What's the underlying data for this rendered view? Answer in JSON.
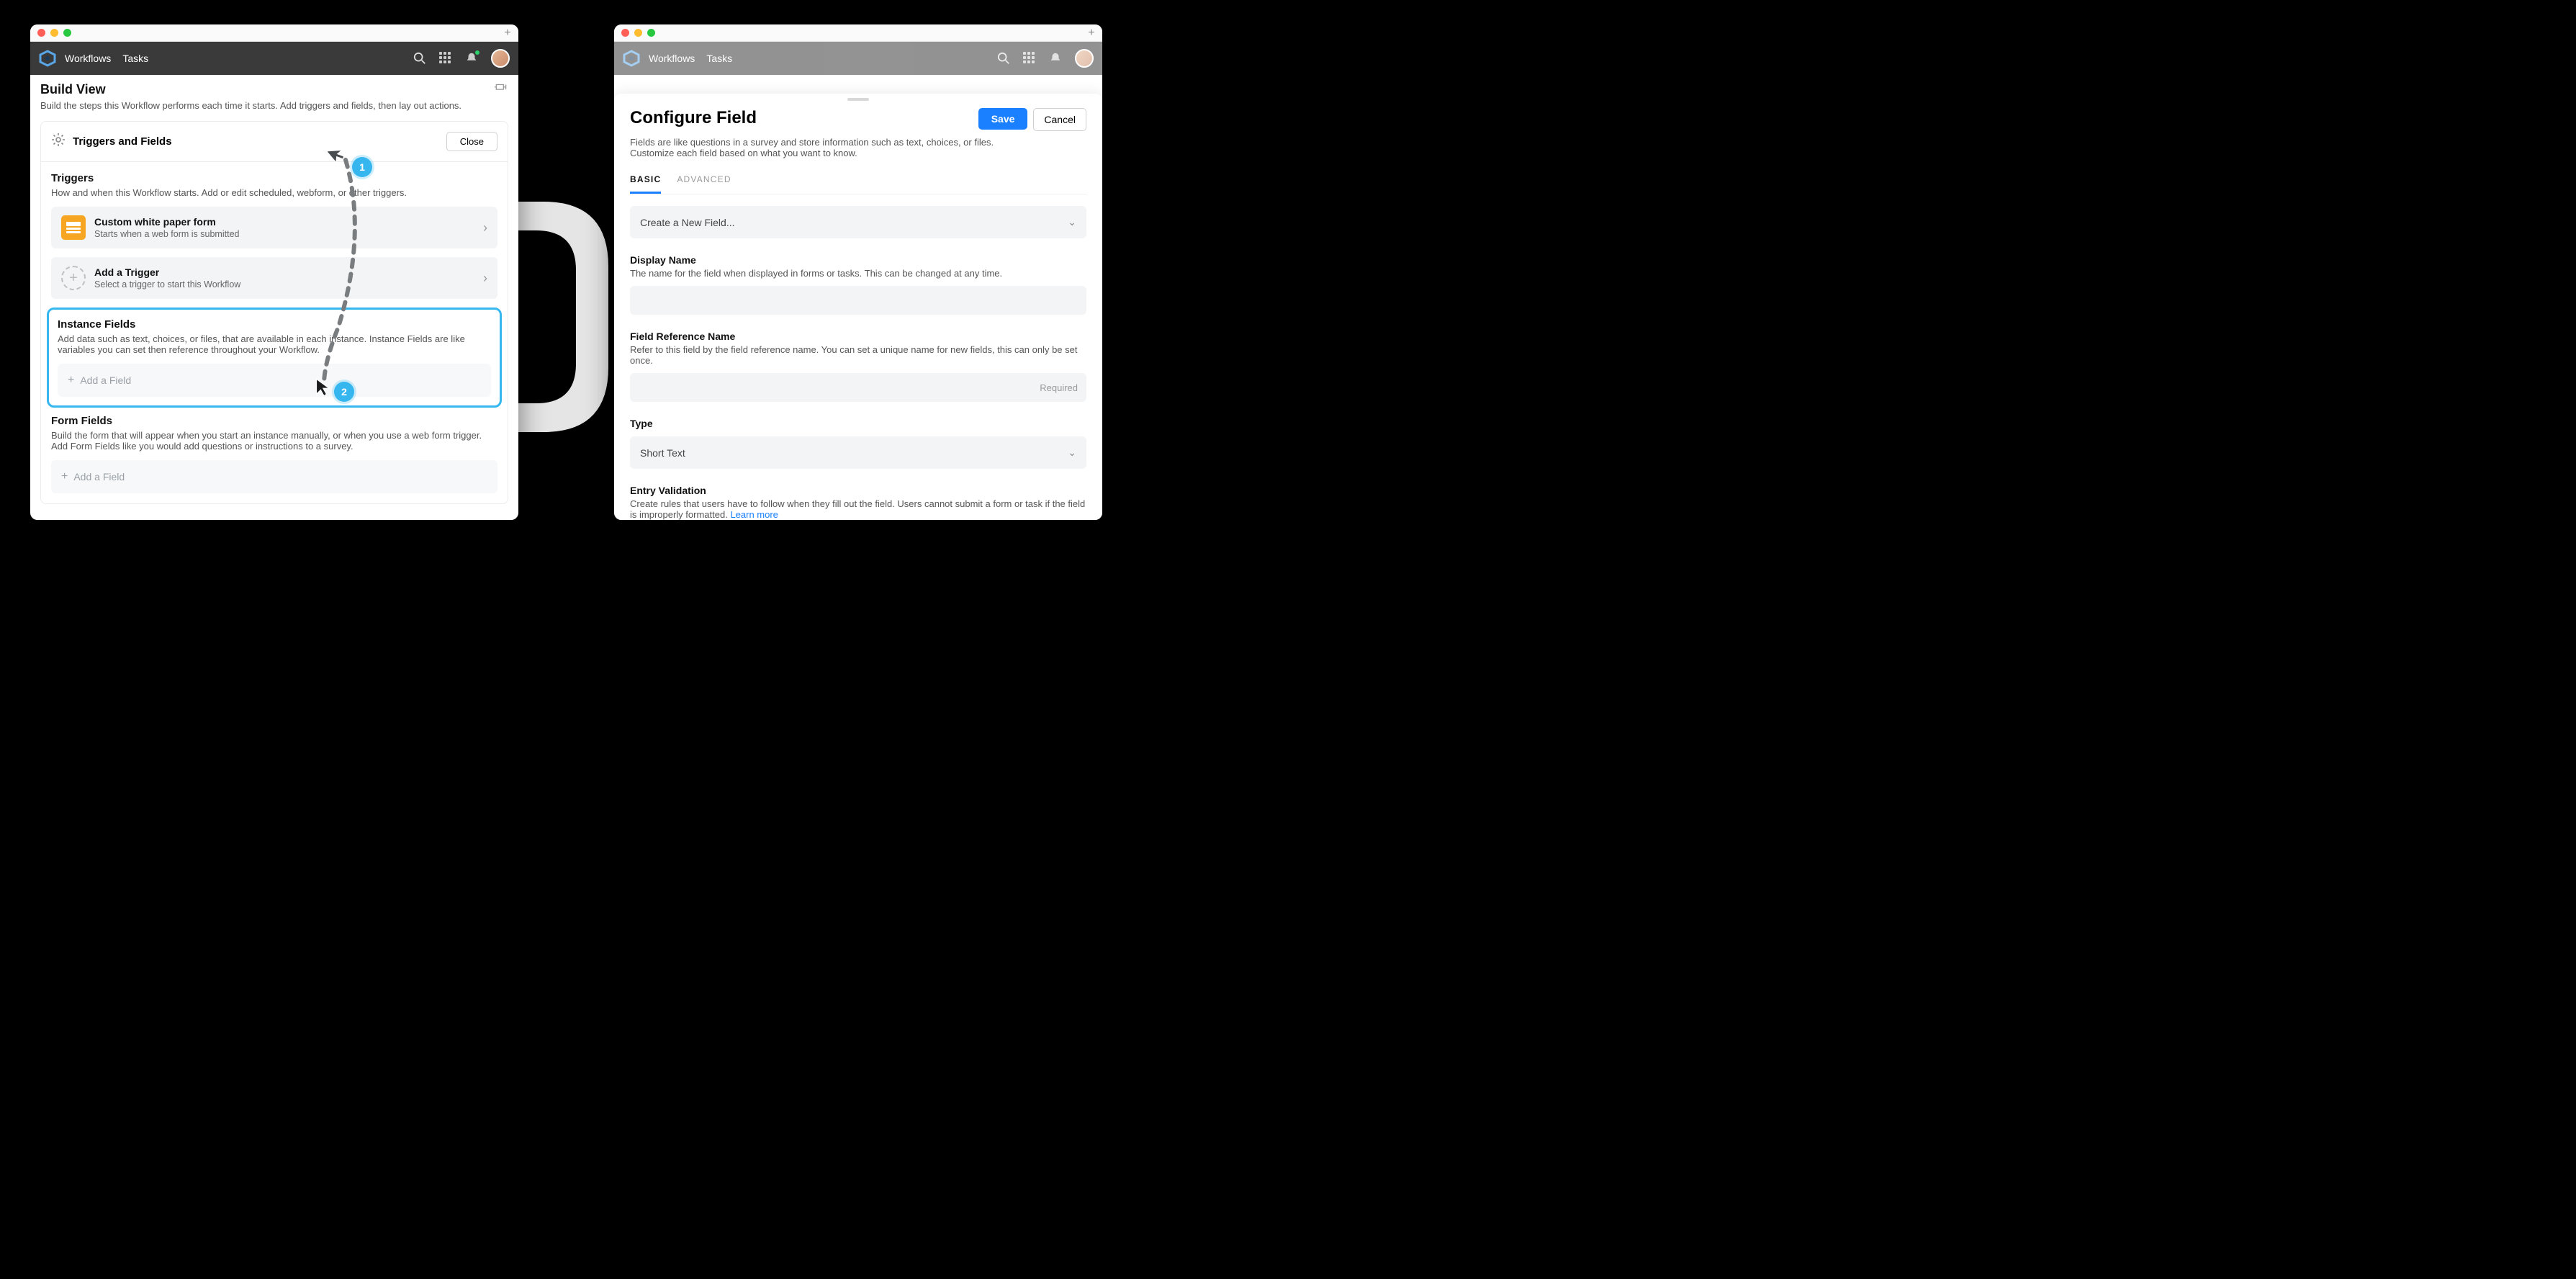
{
  "left": {
    "nav": {
      "link_workflows": "Workflows",
      "link_tasks": "Tasks"
    },
    "build_view": {
      "title": "Build View",
      "subtitle": "Build the steps this Workflow performs each time it starts. Add triggers and fields, then lay out actions."
    },
    "triggers_panel": {
      "title": "Triggers and Fields",
      "close": "Close",
      "triggers_heading": "Triggers",
      "triggers_sub": "How and when this Workflow starts. Add or edit scheduled, webform, or other triggers.",
      "item1_title": "Custom white paper form",
      "item1_sub": "Starts when a web form is submitted",
      "item2_title": "Add a Trigger",
      "item2_sub": "Select a trigger to start this Workflow"
    },
    "instance_fields": {
      "title": "Instance Fields",
      "sub": "Add data such as text, choices, or files, that are available in each instance. Instance Fields are like variables you can set then reference throughout your Workflow.",
      "add": "Add a Field"
    },
    "form_fields": {
      "title": "Form Fields",
      "sub": "Build the form that will appear when you start an instance manually, or when you use a web form trigger. Add Form Fields like you would add questions or instructions to a survey.",
      "add": "Add a Field"
    }
  },
  "right": {
    "nav": {
      "link_workflows": "Workflows",
      "link_tasks": "Tasks"
    },
    "modal": {
      "title": "Configure Field",
      "save": "Save",
      "cancel": "Cancel",
      "sub": "Fields are like questions in a survey and store information such as text, choices, or files. Customize each field based on what you want to know.",
      "tab_basic": "BASIC",
      "tab_advanced": "ADVANCED",
      "select_create": "Create a New Field...",
      "display_label": "Display Name",
      "display_sub": "The name for the field when displayed in forms or tasks. This can be changed at any time.",
      "ref_label": "Field Reference Name",
      "ref_sub": "Refer to this field by the field reference name. You can set a unique name for new fields, this can only be set once.",
      "ref_placeholder": "Required",
      "type_label": "Type",
      "type_value": "Short Text",
      "validation_label": "Entry Validation",
      "validation_sub": "Create rules that users have to follow when they fill out the field. Users cannot submit a form or task if the field is improperly formatted. ",
      "learn_more": "Learn more"
    }
  },
  "annotations": {
    "step1": "1",
    "step2": "2"
  }
}
